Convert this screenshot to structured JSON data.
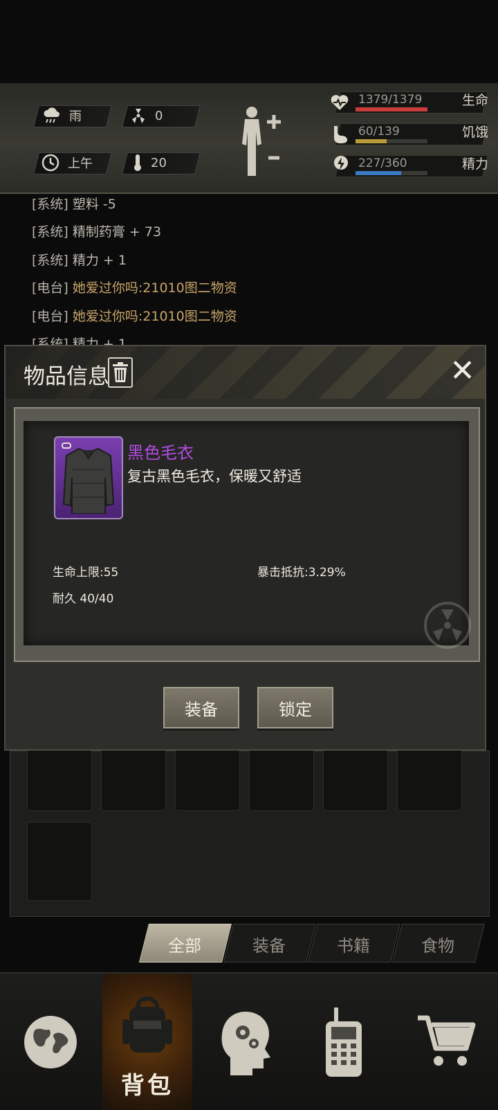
{
  "status": {
    "weather": {
      "icon": "rain-cloud-icon",
      "label": "雨"
    },
    "radiation": {
      "icon": "radiation-icon",
      "value": "0"
    },
    "time": {
      "icon": "clock-icon",
      "label": "上午"
    },
    "temperature": {
      "icon": "thermometer-icon",
      "value": "20"
    },
    "body": {
      "icon": "body-figure-icon"
    },
    "bars": [
      {
        "key": "life",
        "icon": "heart-icon",
        "text": "1379/1379",
        "label": "生命",
        "fraction": 1.0,
        "color": "#c83c3c"
      },
      {
        "key": "hunger",
        "icon": "stomach-icon",
        "text": "60/139",
        "label": "饥饿",
        "fraction": 0.43,
        "color": "#b89a3a"
      },
      {
        "key": "energy",
        "icon": "energy-icon",
        "text": "227/360",
        "label": "精力",
        "fraction": 0.63,
        "color": "#3a7ac0"
      }
    ]
  },
  "log": [
    {
      "tag": "[系统]",
      "msg": "塑料 -5",
      "gold": false
    },
    {
      "tag": "[系统]",
      "msg": "精制药膏 + 73",
      "gold": false
    },
    {
      "tag": "[系统]",
      "msg": "精力 + 1",
      "gold": false
    },
    {
      "tag": "[电台]",
      "msg": "她爱过你吗:21010图二物资",
      "gold": true
    },
    {
      "tag": "[电台]",
      "msg": "她爱过你吗:21010图二物资",
      "gold": true
    },
    {
      "tag": "[系统]",
      "msg": "精力 + 1",
      "gold": false
    }
  ],
  "modal": {
    "title": "物品信息",
    "item": {
      "icon": "sweater-icon",
      "name": "黑色毛衣",
      "description": "复古黑色毛衣，保暖又舒适",
      "stats": {
        "hp_max": "生命上限:55",
        "crit_resist": "暴击抵抗:3.29%",
        "durability": "耐久 40/40"
      }
    },
    "buttons": {
      "equip": "装备",
      "lock": "锁定"
    }
  },
  "tabs": [
    {
      "label": "全部",
      "active": true
    },
    {
      "label": "装备",
      "active": false
    },
    {
      "label": "书籍",
      "active": false
    },
    {
      "label": "食物",
      "active": false
    }
  ],
  "nav": {
    "world": {
      "icon": "globe-icon"
    },
    "bag": {
      "icon": "backpack-icon",
      "label": "背包"
    },
    "skills": {
      "icon": "head-gears-icon"
    },
    "radio": {
      "icon": "walkie-talkie-icon"
    },
    "shop": {
      "icon": "shopping-cart-icon"
    }
  }
}
